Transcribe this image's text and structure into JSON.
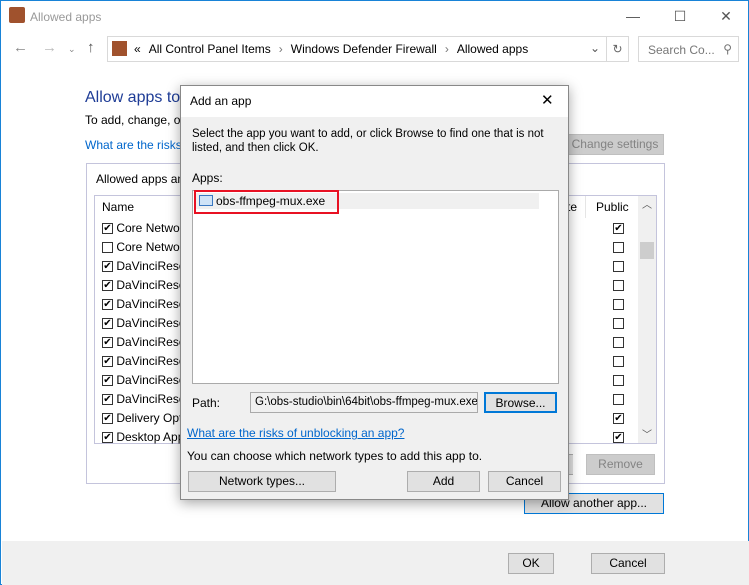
{
  "window": {
    "title": "Allowed apps",
    "minimize": "—",
    "maximize": "☐",
    "close": "✕"
  },
  "address": {
    "prefix": "«",
    "crumbs": [
      "All Control Panel Items",
      "Windows Defender Firewall",
      "Allowed apps"
    ],
    "search_placeholder": "Search Co..."
  },
  "main": {
    "heading": "Allow apps to",
    "description": "To add, change, or",
    "risks_link": "What are the risks",
    "change_settings": "Change settings",
    "group_label": "Allowed apps an",
    "col_name": "Name",
    "col_private": "te",
    "col_public": "Public",
    "rows": [
      {
        "name": "Core Networ",
        "checked": true,
        "public": true
      },
      {
        "name": "Core Networ",
        "checked": false,
        "public": false
      },
      {
        "name": "DaVinciReso",
        "checked": true,
        "public": false
      },
      {
        "name": "DaVinciReso",
        "checked": true,
        "public": false
      },
      {
        "name": "DaVinciReso",
        "checked": true,
        "public": false
      },
      {
        "name": "DaVinciReso",
        "checked": true,
        "public": false
      },
      {
        "name": "DaVinciReso",
        "checked": true,
        "public": false
      },
      {
        "name": "DaVinciReso",
        "checked": true,
        "public": false
      },
      {
        "name": "DaVinciReso",
        "checked": true,
        "public": false
      },
      {
        "name": "DaVinciReso",
        "checked": true,
        "public": false
      },
      {
        "name": "Delivery Opt",
        "checked": true,
        "public": true
      },
      {
        "name": "Desktop App",
        "checked": true,
        "public": true
      }
    ],
    "remove": "Remove",
    "allow_another": "Allow another app..."
  },
  "footer": {
    "ok": "OK",
    "cancel": "Cancel"
  },
  "dialog": {
    "title": "Add an app",
    "close": "✕",
    "instructions": "Select the app you want to add, or click Browse to find one that is not listed, and then click OK.",
    "apps_label": "Apps:",
    "apps": [
      "obs-ffmpeg-mux.exe"
    ],
    "path_label": "Path:",
    "path_value": "G:\\obs-studio\\bin\\64bit\\obs-ffmpeg-mux.exe",
    "browse": "Browse...",
    "risks_link": "What are the risks of unblocking an app?",
    "network_note": "You can choose which network types to add this app to.",
    "network_types": "Network types...",
    "add": "Add",
    "cancel": "Cancel",
    "highlight_color": "#e81123"
  }
}
